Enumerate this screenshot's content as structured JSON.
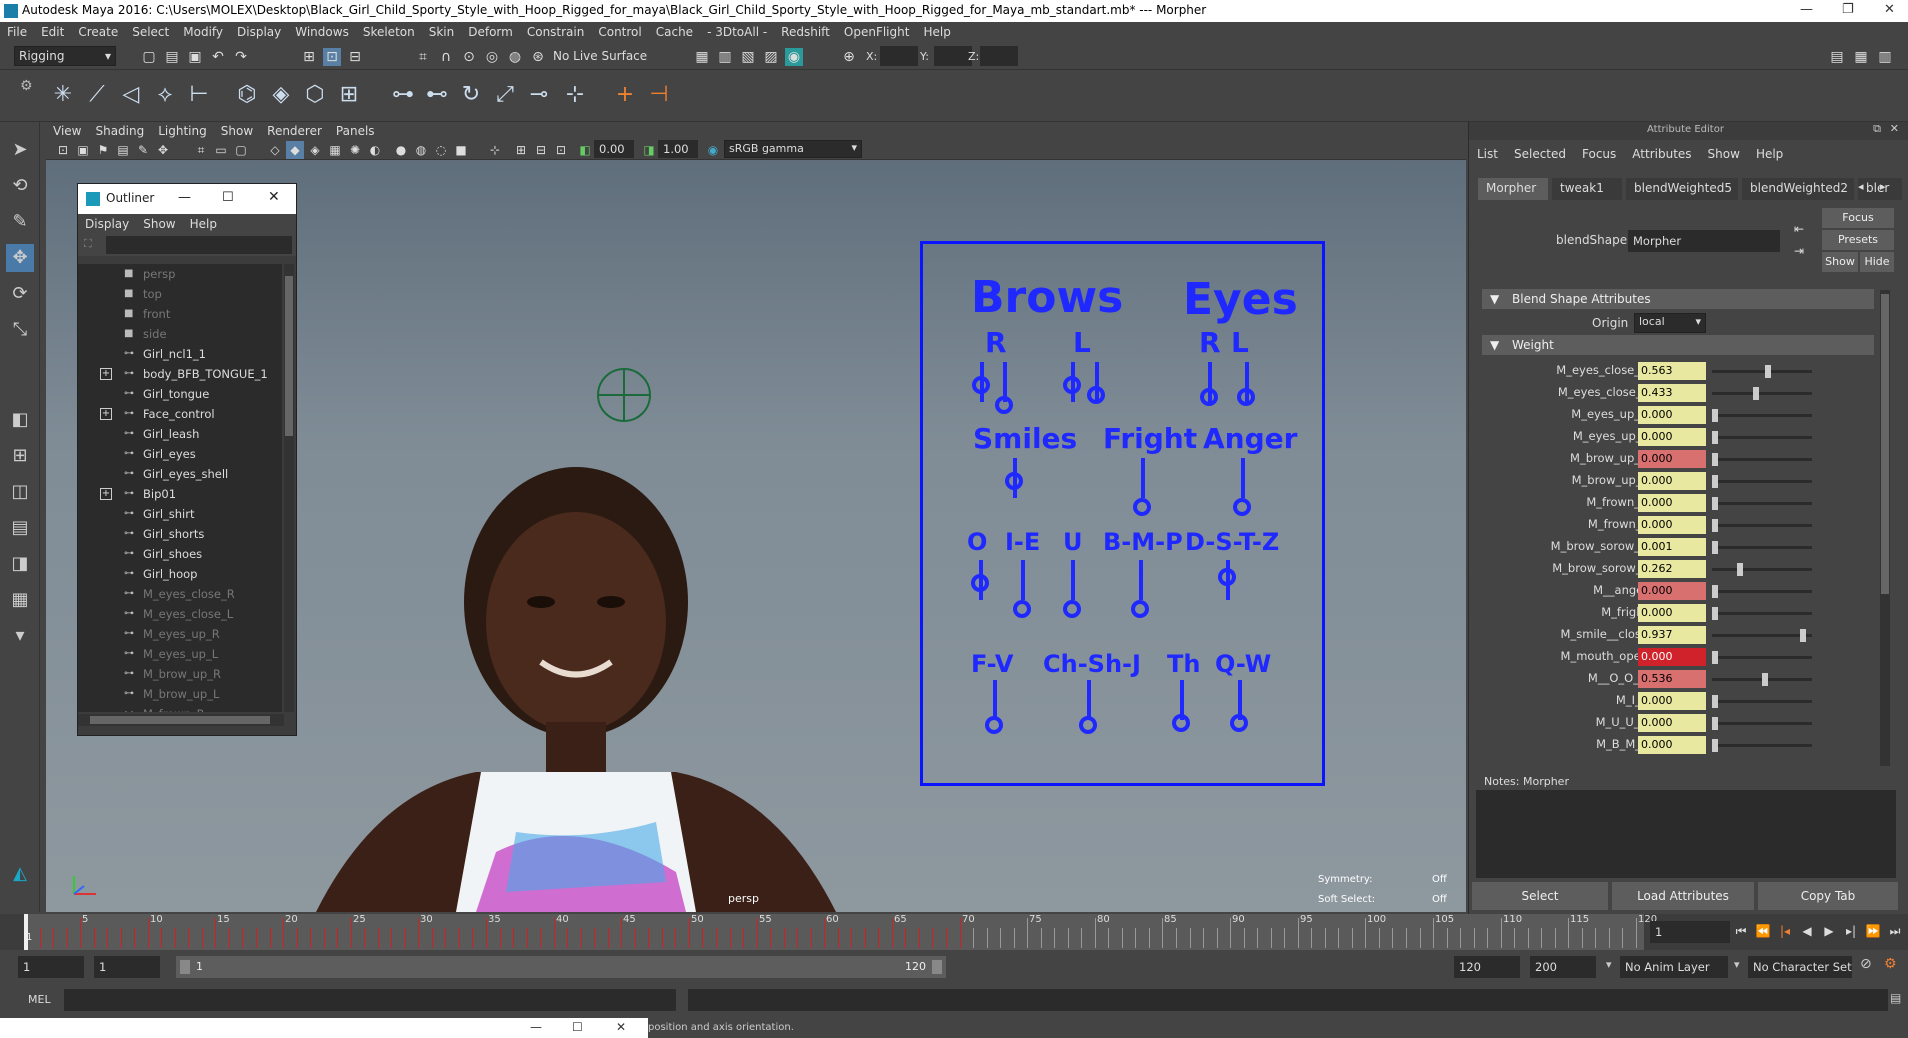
{
  "window": {
    "title": "Autodesk Maya 2016: C:\\Users\\MOLEX\\Desktop\\Black_Girl_Child_Sporty_Style_with_Hoop_Rigged_for_maya\\Black_Girl_Child_Sporty_Style_with_Hoop_Rigged_for_Maya_mb_standart.mb*  ---  Morpher"
  },
  "menubar": [
    "File",
    "Edit",
    "Create",
    "Select",
    "Modify",
    "Display",
    "Windows",
    "Skeleton",
    "Skin",
    "Deform",
    "Constrain",
    "Control",
    "Cache",
    "- 3DtoAll -",
    "Redshift",
    "OpenFlight",
    "Help"
  ],
  "toolbar": {
    "menuset": "Rigging",
    "live_surface": "No Live Surface",
    "x_label": "X:",
    "y_label": "Y:",
    "z_label": "Z:"
  },
  "viewport": {
    "menu": [
      "View",
      "Shading",
      "Lighting",
      "Show",
      "Renderer",
      "Panels"
    ],
    "near_value": "0.00",
    "far_value": "1.00",
    "color_space": "sRGB gamma",
    "camera_label": "persp",
    "symmetry_label": "Symmetry:",
    "symmetry_value": "Off",
    "soft_select_label": "Soft Select:",
    "soft_select_value": "Off"
  },
  "outliner": {
    "title": "Outliner",
    "menu": [
      "Display",
      "Show",
      "Help"
    ],
    "items": [
      {
        "label": "persp",
        "dim": true,
        "expand": false
      },
      {
        "label": "top",
        "dim": true,
        "expand": false
      },
      {
        "label": "front",
        "dim": true,
        "expand": false
      },
      {
        "label": "side",
        "dim": true,
        "expand": false
      },
      {
        "label": "Girl_ncl1_1",
        "dim": false,
        "expand": false
      },
      {
        "label": "body_BFB_TONGUE_1",
        "dim": false,
        "expand": true
      },
      {
        "label": "Girl_tongue",
        "dim": false,
        "expand": false
      },
      {
        "label": "Face_control",
        "dim": false,
        "expand": true
      },
      {
        "label": "Girl_leash",
        "dim": false,
        "expand": false
      },
      {
        "label": "Girl_eyes",
        "dim": false,
        "expand": false
      },
      {
        "label": "Girl_eyes_shell",
        "dim": false,
        "expand": false
      },
      {
        "label": "Bip01",
        "dim": false,
        "expand": true
      },
      {
        "label": "Girl_shirt",
        "dim": false,
        "expand": false
      },
      {
        "label": "Girl_shorts",
        "dim": false,
        "expand": false
      },
      {
        "label": "Girl_shoes",
        "dim": false,
        "expand": false
      },
      {
        "label": "Girl_hoop",
        "dim": false,
        "expand": false
      },
      {
        "label": "M_eyes_close_R",
        "dim": true,
        "expand": false
      },
      {
        "label": "M_eyes_close_L",
        "dim": true,
        "expand": false
      },
      {
        "label": "M_eyes_up_R",
        "dim": true,
        "expand": false
      },
      {
        "label": "M_eyes_up_L",
        "dim": true,
        "expand": false
      },
      {
        "label": "M_brow_up_R",
        "dim": true,
        "expand": false
      },
      {
        "label": "M_brow_up_L",
        "dim": true,
        "expand": false
      },
      {
        "label": "M_frown_R",
        "dim": true,
        "expand": false
      }
    ]
  },
  "control_board": {
    "brows": "Brows",
    "eyes": "Eyes",
    "brows_r": "R",
    "brows_l": "L",
    "eyes_r": "R",
    "eyes_l": "L",
    "smiles": "Smiles",
    "fright": "Fright",
    "anger": "Anger",
    "o": "O",
    "i_e": "I-E",
    "u": "U",
    "b_m_p": "B-M-P",
    "d_s_t_z": "D-S-T-Z",
    "f_v": "F-V",
    "ch_sh_j": "Ch-Sh-J",
    "th": "Th",
    "q_w": "Q-W"
  },
  "attribute_editor": {
    "title": "Attribute Editor",
    "menu": [
      "List",
      "Selected",
      "Focus",
      "Attributes",
      "Show",
      "Help"
    ],
    "tabs": [
      "Morpher",
      "tweak1",
      "blendWeighted5",
      "blendWeighted2",
      "bler"
    ],
    "blendshape_label": "blendShape:",
    "blendshape_value": "Morpher",
    "focus_btn": "Focus",
    "presets_btn": "Presets",
    "show_btn": "Show",
    "hide_btn": "Hide",
    "section_blend": "Blend Shape Attributes",
    "origin_label": "Origin",
    "origin_value": "local",
    "section_weight": "Weight",
    "weights": [
      {
        "name": "M_eyes_close_R",
        "value": "0.563",
        "v": 0.563,
        "state": "normal"
      },
      {
        "name": "M_eyes_close_L",
        "value": "0.433",
        "v": 0.433,
        "state": "normal"
      },
      {
        "name": "M_eyes_up_R",
        "value": "0.000",
        "v": 0,
        "state": "normal"
      },
      {
        "name": "M_eyes_up_L",
        "value": "0.000",
        "v": 0,
        "state": "normal"
      },
      {
        "name": "M_brow_up_R",
        "value": "0.000",
        "v": 0,
        "state": "red"
      },
      {
        "name": "M_brow_up_L",
        "value": "0.000",
        "v": 0,
        "state": "normal"
      },
      {
        "name": "M_frown_R",
        "value": "0.000",
        "v": 0,
        "state": "normal"
      },
      {
        "name": "M_frown_L",
        "value": "0.000",
        "v": 0,
        "state": "normal"
      },
      {
        "name": "M_brow_sorow_R",
        "value": "0.001",
        "v": 0.001,
        "state": "normal"
      },
      {
        "name": "M_brow_sorow_L",
        "value": "0.262",
        "v": 0.262,
        "state": "normal"
      },
      {
        "name": "M__anger",
        "value": "0.000",
        "v": 0,
        "state": "red"
      },
      {
        "name": "M_fright",
        "value": "0.000",
        "v": 0,
        "state": "normal"
      },
      {
        "name": "M_smile__close",
        "value": "0.937",
        "v": 0.937,
        "state": "normal"
      },
      {
        "name": "M_mouth_open",
        "value": "0.000",
        "v": 0,
        "state": "hot"
      },
      {
        "name": "M__O_O_O",
        "value": "0.536",
        "v": 0.536,
        "state": "red"
      },
      {
        "name": "M_I_E",
        "value": "0.000",
        "v": 0,
        "state": "normal"
      },
      {
        "name": "M_U_U_U",
        "value": "0.000",
        "v": 0,
        "state": "normal"
      },
      {
        "name": "M_B_M_P",
        "value": "0.000",
        "v": 0,
        "state": "normal"
      }
    ],
    "notes": "Notes:  Morpher",
    "select_btn": "Select",
    "load_btn": "Load Attributes",
    "copy_btn": "Copy Tab"
  },
  "timeline": {
    "ticks": [
      "5",
      "10",
      "15",
      "20",
      "25",
      "30",
      "35",
      "40",
      "45",
      "50",
      "55",
      "60",
      "65",
      "70",
      "75",
      "80",
      "85",
      "90",
      "95",
      "100",
      "105",
      "110",
      "115",
      "120"
    ],
    "current_frame": "1",
    "start_frame_label": "1"
  },
  "range": {
    "start": "1",
    "inner_start": "1",
    "slider_start": "1",
    "slider_end": "120",
    "end": "120",
    "total_end": "200",
    "anim_layer": "No Anim Layer",
    "char_set": "No Character Set"
  },
  "command": {
    "mel_label": "MEL",
    "status_text": "position and axis orientation."
  }
}
